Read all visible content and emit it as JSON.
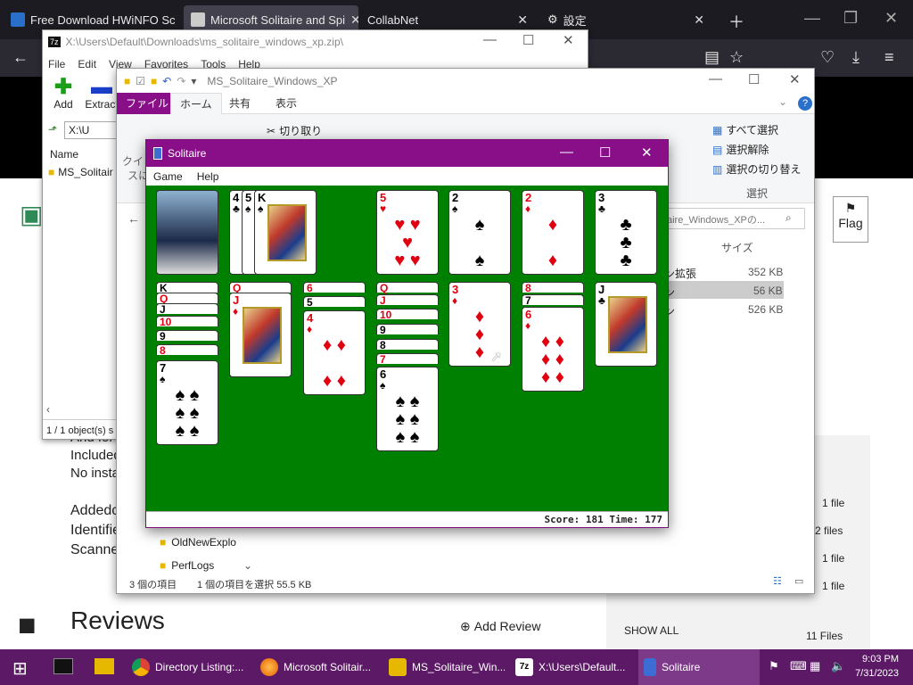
{
  "browser": {
    "tabs": [
      {
        "label": "Free Download HWiNFO Sc"
      },
      {
        "label": "Microsoft Solitaire and Spi"
      },
      {
        "label": "CollabNet"
      },
      {
        "label": "設定"
      }
    ]
  },
  "webpage": {
    "lines": [
      "And for",
      "Included",
      "No insta",
      "Addedc",
      "Identifie",
      "Scanne"
    ],
    "reviews_heading": "Reviews",
    "add_review": "Add Review",
    "flag_label": "Flag",
    "right_files": [
      "1 file",
      "2 files",
      "1 file",
      "1 file"
    ],
    "show_all": "SHOW ALL",
    "file_count": "11 Files"
  },
  "zip_window": {
    "title": "X:\\Users\\Default\\Downloads\\ms_solitaire_windows_xp.zip\\",
    "menu": [
      "File",
      "Edit",
      "View",
      "Favorites",
      "Tools",
      "Help"
    ],
    "toolbar": [
      "Add",
      "Extract"
    ],
    "address": "X:\\U",
    "col_name": "Name",
    "row": "MS_Solitair",
    "status": "1 / 1 object(s) s"
  },
  "explorer": {
    "title": "MS_Solitaire_Windows_XP",
    "ribbon_tabs": [
      "ファイル",
      "ホーム",
      "共有",
      "表示"
    ],
    "ribbon_items": {
      "cut": "切り取り",
      "move_to": "移動先",
      "delete": "削除",
      "select_all": "すべて選択",
      "select_none": "選択解除",
      "invert": "選択の切り替え",
      "select_group": "選択",
      "quick": "クイッ",
      "quick2": "スに"
    },
    "search_placeholder": "aire_Windows_XPの...",
    "size_header": "サイズ",
    "files": [
      {
        "name": "ン拡張",
        "size": "352 KB"
      },
      {
        "name": "ン",
        "size": "56 KB"
      },
      {
        "name": "ン",
        "size": "526 KB"
      }
    ],
    "tree": [
      "OldNewExplo",
      "PerfLogs"
    ],
    "status_count": "3 個の項目",
    "status_selected": "1 個の項目を選択  55.5 KB"
  },
  "solitaire": {
    "title": "Solitaire",
    "menu": [
      "Game",
      "Help"
    ],
    "status": "Score: 181 Time: 177",
    "waste": [
      "4",
      "5",
      "K"
    ],
    "foundations": [
      {
        "rank": "5",
        "suit": "♥"
      },
      {
        "rank": "2",
        "suit": "♠"
      },
      {
        "rank": "2",
        "suit": "♦"
      },
      {
        "rank": "3",
        "suit": "♣"
      }
    ],
    "tableau": [
      {
        "strips": [
          "K",
          "Q",
          "J",
          "10",
          "9",
          "8"
        ],
        "top_rank": "7",
        "top_suit": "♠"
      },
      {
        "strips": [
          "Q"
        ],
        "top_rank": "J",
        "top_suit": "♦"
      },
      {
        "strips": [
          "6",
          "5"
        ],
        "top_rank": "4",
        "top_suit": "♦"
      },
      {
        "strips": [
          "Q",
          "J",
          "10",
          "9",
          "8",
          "7"
        ],
        "top_rank": "6",
        "top_suit": "♠"
      },
      {
        "strips": [],
        "top_rank": "3",
        "top_suit": "♦"
      },
      {
        "strips": [
          "8",
          "7"
        ],
        "top_rank": "6",
        "top_suit": "♦"
      },
      {
        "strips": [],
        "top_rank": "J",
        "top_suit": "♣"
      }
    ]
  },
  "taskbar": {
    "items": [
      {
        "label": "Directory Listing:..."
      },
      {
        "label": "Microsoft Solitair..."
      },
      {
        "label": "MS_Solitaire_Win..."
      },
      {
        "label": "X:\\Users\\Default..."
      },
      {
        "label": "Solitaire"
      }
    ],
    "time": "9:03 PM",
    "date": "7/31/2023"
  }
}
